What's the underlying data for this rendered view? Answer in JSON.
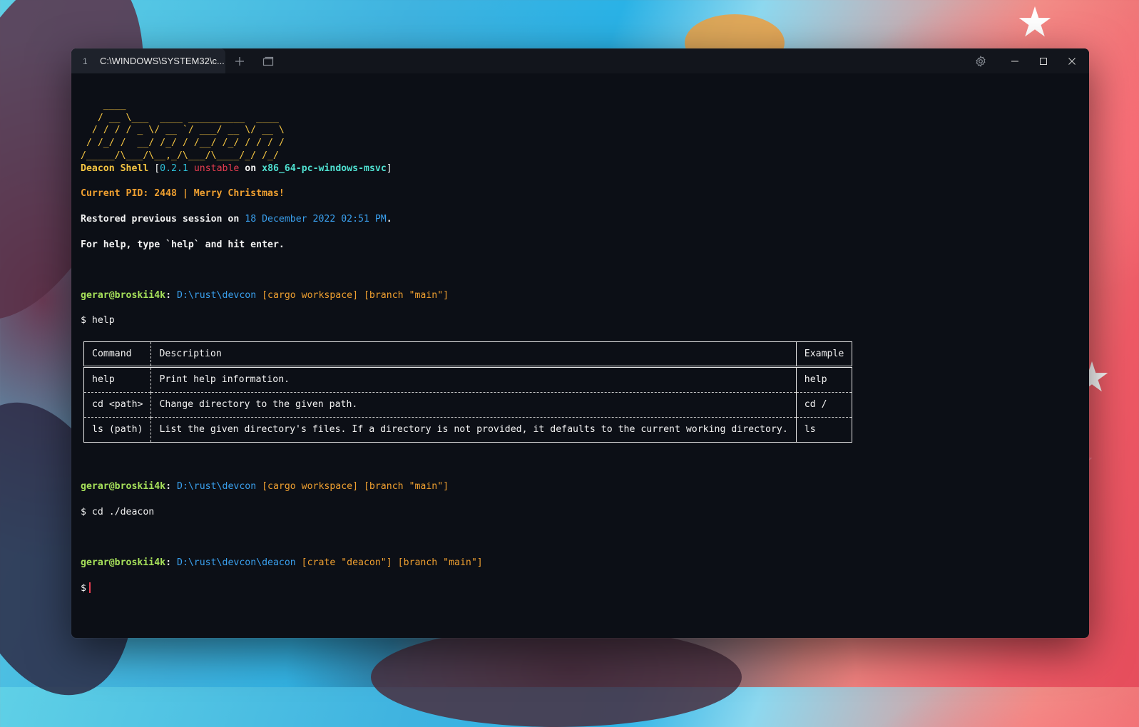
{
  "window": {
    "tab_number": "1",
    "tab_title": "C:\\WINDOWS\\SYSTEM32\\c...",
    "new_tab_symbol": "+",
    "icons": [
      "plus-icon",
      "window-duplicate-icon",
      "gear-icon",
      "minimize-icon",
      "maximize-icon",
      "close-icon"
    ]
  },
  "banner": {
    "ascii_art": "    ____\n   / __ \\___  ____ __________  ____\n  / / / / _ \\/ __ `/ ___/ __ \\/ __ \\\n / /_/ /  __/ /_/ / /__/ /_/ / / / /\n/_____/\\___/\\__,_/\\___/\\____/_/ /_/",
    "name": "Deacon Shell",
    "bracket_open": " [",
    "version": "0.2.1",
    "channel": "unstable",
    "on_word": " on ",
    "target": "x86_64-pc-windows-msvc",
    "bracket_close": "]",
    "pid_line": "Current PID: 2448 | Merry Christmas!",
    "restored_prefix": "Restored previous session on ",
    "restored_date": "18 December 2022 02:51 PM",
    "restored_suffix": ".",
    "help_hint": "For help, type `help` and hit enter."
  },
  "prompts": [
    {
      "user": "gerar@broskii4k",
      "colon": ": ",
      "path": "D:\\rust\\devcon",
      "tags": " [cargo workspace] [branch \"main\"]",
      "command": "$ help"
    },
    {
      "user": "gerar@broskii4k",
      "colon": ": ",
      "path": "D:\\rust\\devcon",
      "tags": " [cargo workspace] [branch \"main\"]",
      "command": "$ cd ./deacon"
    },
    {
      "user": "gerar@broskii4k",
      "colon": ": ",
      "path": "D:\\rust\\devcon\\deacon",
      "tags": " [crate \"deacon\"] [branch \"main\"]",
      "command": "$"
    }
  ],
  "help_table": {
    "headers": [
      "Command",
      "Description",
      "Example"
    ],
    "rows": [
      [
        "help",
        "Print help information.",
        "help"
      ],
      [
        "cd <path>",
        "Change directory to the given path.",
        "cd /"
      ],
      [
        "ls (path)",
        "List the given directory's files. If a directory is not provided, it defaults to the current working directory.",
        "ls"
      ]
    ]
  },
  "colors": {
    "terminal_bg": "#0c0f16",
    "titlebar_bg": "#12151c",
    "ascii_yellow": "#f5c542",
    "prompt_user_green": "#a6e05a",
    "path_blue": "#3aa0ee",
    "tag_orange": "#f0a030",
    "unstable_red": "#e83d50",
    "version_cyan": "#2dc0d8",
    "cursor_red": "#e83d50"
  }
}
